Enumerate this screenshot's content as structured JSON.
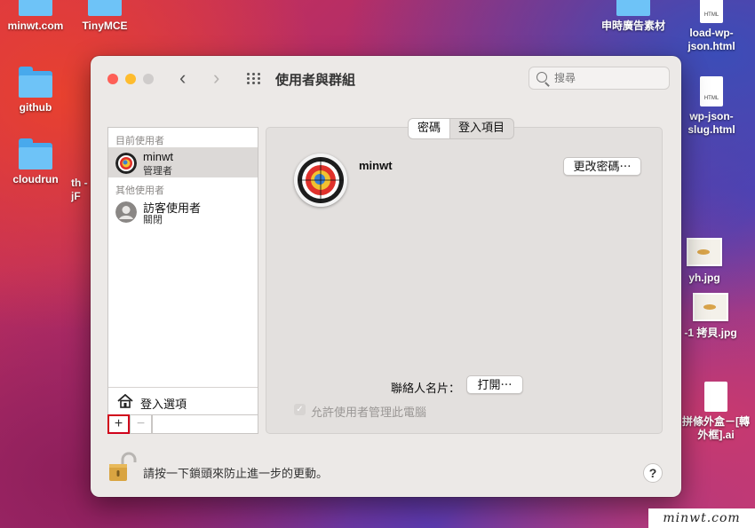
{
  "desktop": {
    "icons": [
      {
        "label": "minwt.com"
      },
      {
        "label": "TinyMCE"
      },
      {
        "label": "github"
      },
      {
        "label": "cloudrun"
      },
      {
        "label": "th -jF"
      },
      {
        "label": "申時廣告素材"
      },
      {
        "label": "load-wp-json.html"
      },
      {
        "label": "wp-json-slug.html"
      },
      {
        "label": "yh.jpg"
      },
      {
        "label": "-1 拷貝.jpg"
      },
      {
        "label": "拼條外盒－[轉 外框].ai"
      }
    ],
    "file_tag": "HTML"
  },
  "window": {
    "title": "使用者與群組",
    "search_placeholder": "搜尋",
    "sidebar": {
      "current_users_label": "目前使用者",
      "other_users_label": "其他使用者",
      "users": [
        {
          "name": "minwt",
          "role": "管理者",
          "selected": true
        },
        {
          "name": "訪客使用者",
          "role": "關閉",
          "selected": false
        }
      ],
      "login_options": "登入選項",
      "add_symbol": "+",
      "remove_symbol": "−"
    },
    "tabs": [
      {
        "label": "密碼",
        "active": true
      },
      {
        "label": "登入項目",
        "active": false
      }
    ],
    "user_name": "minwt",
    "change_password": "更改密碼⋯",
    "contact_card_label": "聯絡人名片：",
    "open_button": "打開⋯",
    "allow_admin_label": "允許使用者管理此電腦",
    "lock_text": "請按一下鎖頭來防止進一步的更動。",
    "help": "?"
  },
  "watermark": "minwt.com",
  "colors": {
    "accent_red": "#d0021b",
    "close": "#fe5f57",
    "minimize": "#febc2e"
  }
}
